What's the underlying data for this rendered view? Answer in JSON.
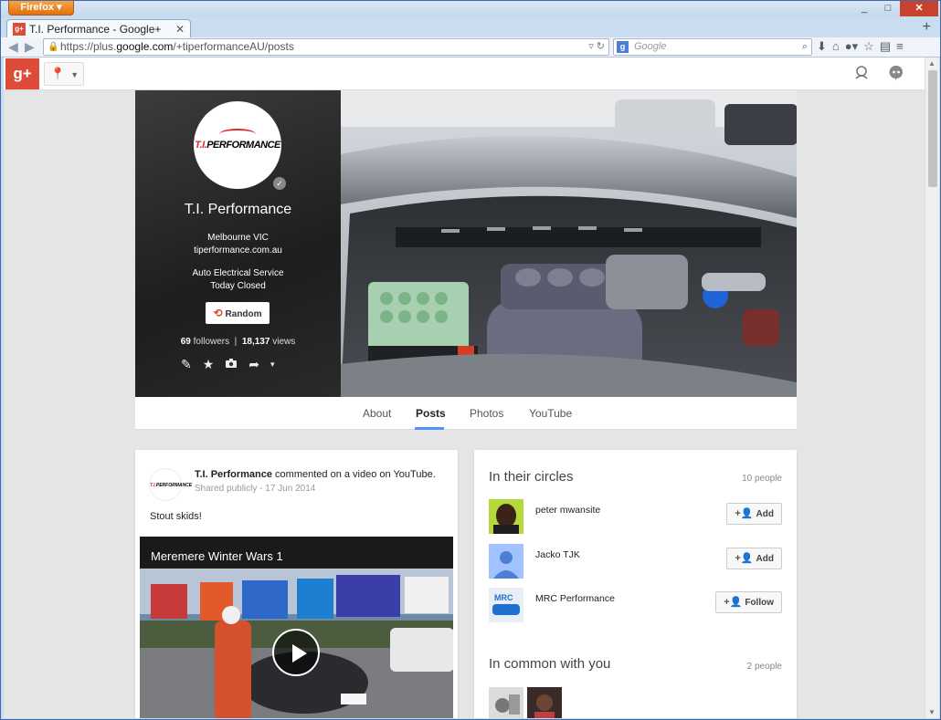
{
  "browser": {
    "app_button": "Firefox",
    "tab_title": "T.I. Performance - Google+",
    "url_prefix": "https://plus.",
    "url_domain": "google.com",
    "url_suffix": "/+tiperformanceAU/posts",
    "search_placeholder": "Google",
    "window_controls": {
      "minimize": "_",
      "maximize": "□",
      "close": "✕"
    }
  },
  "gplus_bar": {
    "logo": "g+"
  },
  "profile": {
    "logo_text_prefix": "T.I.",
    "logo_text_suffix": "PERFORMANCE",
    "name": "T.I. Performance",
    "location": "Melbourne VIC",
    "website": "tiperformance.com.au",
    "category": "Auto Electrical Service",
    "hours": "Today Closed",
    "random_label": "Random",
    "followers_count": "69",
    "followers_label": "followers",
    "views_count": "18,137",
    "views_label": "views"
  },
  "tabs": [
    {
      "label": "About",
      "active": false
    },
    {
      "label": "Posts",
      "active": true
    },
    {
      "label": "Photos",
      "active": false
    },
    {
      "label": "YouTube",
      "active": false
    }
  ],
  "post": {
    "author": "T.I. Performance",
    "action": "commented on a video on YouTube.",
    "visibility": "Shared publicly",
    "date": "17 Jun 2014",
    "text": "Stout skids!",
    "video_title": "Meremere Winter Wars 1"
  },
  "circles": {
    "title": "In their circles",
    "count": "10 people",
    "people": [
      {
        "name": "peter mwansite",
        "button": "Add"
      },
      {
        "name": "Jacko TJK",
        "button": "Add"
      },
      {
        "name": "MRC Performance",
        "button": "Follow"
      }
    ]
  },
  "common": {
    "title": "In common with you",
    "count": "2 people"
  },
  "colors": {
    "gplus_red": "#dd4b39",
    "tab_active": "#4d90fe",
    "firefox_orange": "#e8800f"
  }
}
